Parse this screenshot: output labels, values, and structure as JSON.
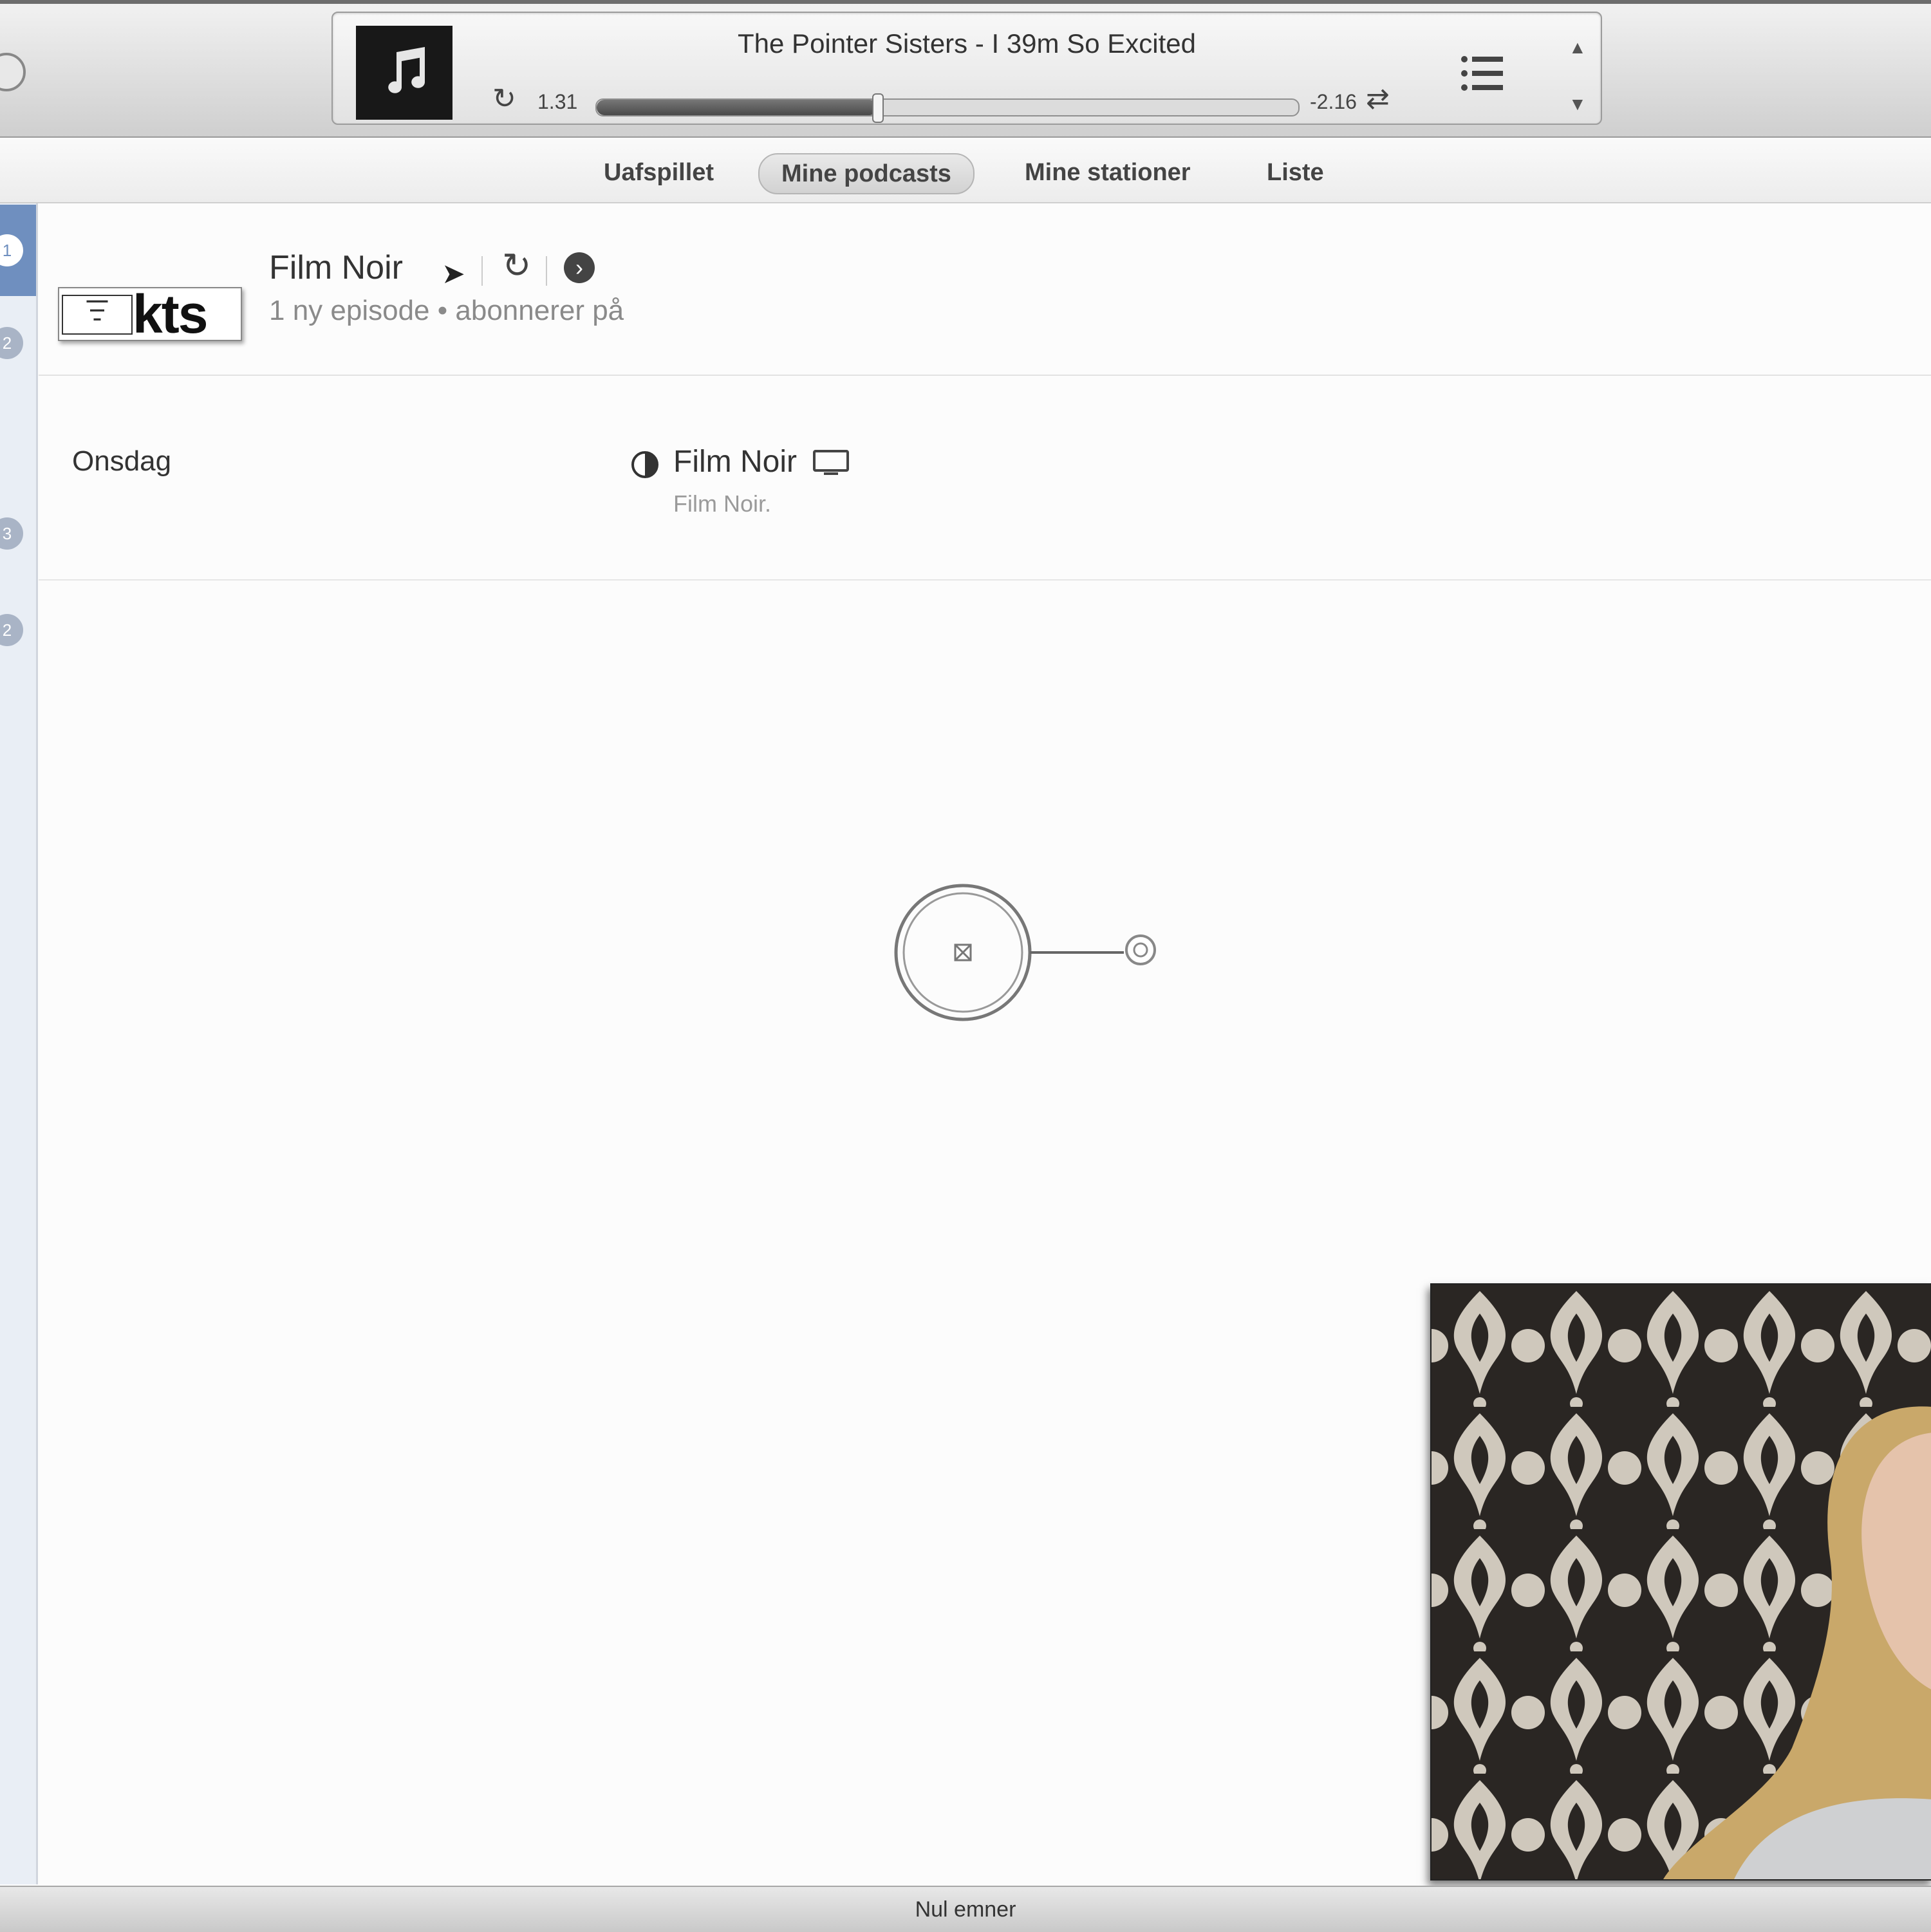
{
  "now_playing": {
    "track": "The Pointer Sisters - I 39m So Excited",
    "elapsed": "1.31",
    "remaining": "-2.16",
    "progress_percent": 40
  },
  "nav": {
    "tabs": [
      "Uafspillet",
      "Mine podcasts",
      "Mine stationer",
      "Liste"
    ],
    "selected": "Mine podcasts"
  },
  "sidebar": {
    "badges": [
      "1",
      "2",
      "3",
      "2"
    ]
  },
  "podcast": {
    "logo_text": "kts",
    "title": "Film Noir",
    "subinfo": "1 ny episode • abonnerer på"
  },
  "episode": {
    "day": "Onsdag",
    "title": "Film Noir",
    "description": "Film Noir."
  },
  "status": {
    "text": "Nul emner"
  },
  "colors": {
    "sidebar_selected": "#6f8fbf",
    "toolbar_top": "#f2f2f2",
    "toolbar_bottom": "#cfcfcf"
  },
  "icons": [
    "music-note-icon",
    "repeat-icon",
    "shuffle-icon",
    "up-next-list-icon",
    "arrow-up-icon",
    "arrow-down-icon",
    "refresh-icon",
    "goto-arrow-icon",
    "half-circle-icon",
    "tv-icon",
    "mouse-cursor-icon"
  ]
}
